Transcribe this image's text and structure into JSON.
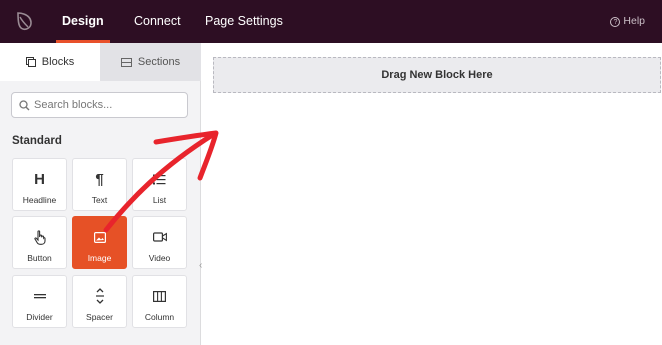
{
  "topbar": {
    "tabs": [
      {
        "label": "Design",
        "active": true
      },
      {
        "label": "Connect",
        "active": false
      },
      {
        "label": "Page Settings",
        "active": false
      }
    ],
    "help_label": "Help",
    "help_glyph": "?"
  },
  "sidebar": {
    "tabs": [
      {
        "label": "Blocks",
        "icon": "blocks-icon",
        "active": true
      },
      {
        "label": "Sections",
        "icon": "sections-icon",
        "active": false
      }
    ],
    "search": {
      "placeholder": "Search blocks...",
      "value": ""
    },
    "section_title": "Standard",
    "blocks": [
      {
        "label": "Headline",
        "icon": "headline-icon",
        "glyph": "H"
      },
      {
        "label": "Text",
        "icon": "paragraph-icon",
        "glyph": "¶"
      },
      {
        "label": "List",
        "icon": "list-icon"
      },
      {
        "label": "Button",
        "icon": "pointer-icon"
      },
      {
        "label": "Image",
        "icon": "image-icon",
        "active": true
      },
      {
        "label": "Video",
        "icon": "video-icon"
      },
      {
        "label": "Divider",
        "icon": "divider-icon"
      },
      {
        "label": "Spacer",
        "icon": "spacer-icon"
      },
      {
        "label": "Column",
        "icon": "column-icon"
      }
    ]
  },
  "canvas": {
    "dropzone_label": "Drag New Block Here"
  },
  "colors": {
    "topbar_bg": "#2d0e23",
    "accent": "#e65126",
    "annotation_arrow": "#e8242c"
  }
}
